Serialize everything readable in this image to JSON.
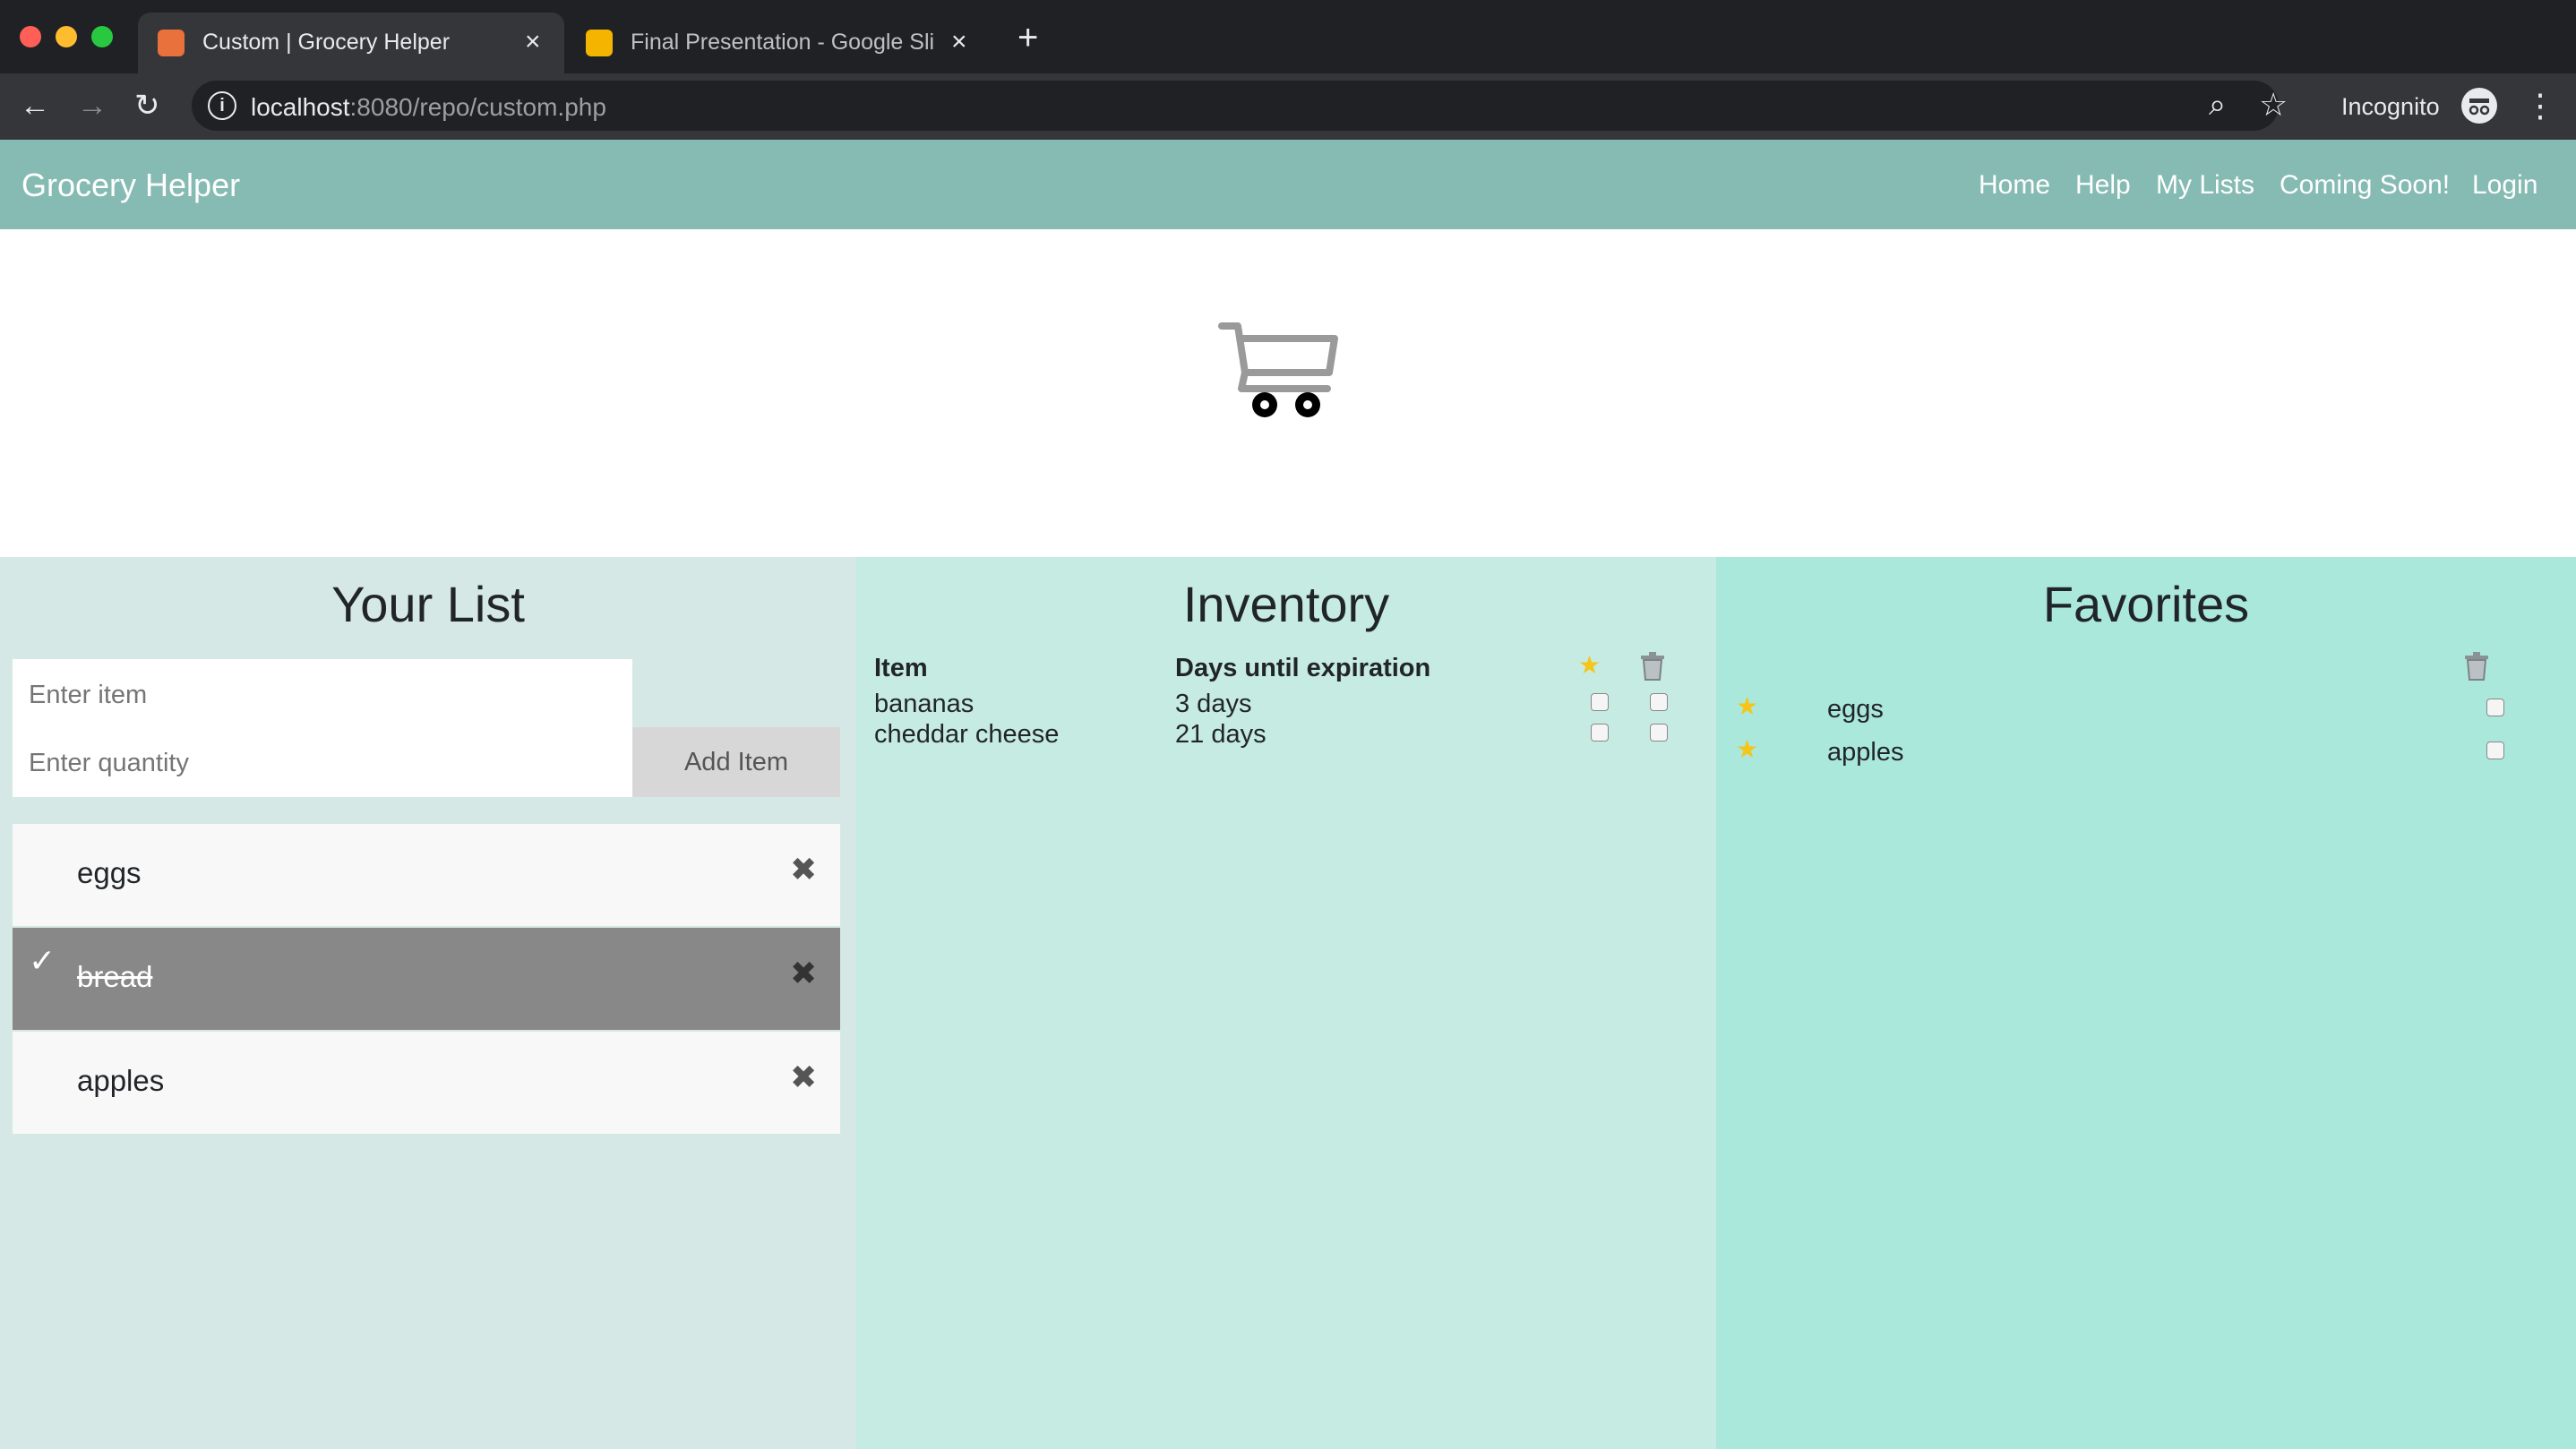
{
  "browser": {
    "tabs": [
      {
        "title": "Custom | Grocery Helper",
        "favicon_color": "#e8713c"
      },
      {
        "title": "Final Presentation - Google Sli",
        "favicon_color": "#f5b400"
      }
    ],
    "new_tab_icon": "plus-icon",
    "url_host": "localhost",
    "url_path": ":8080/repo/custom.php",
    "profile_label": "Incognito"
  },
  "navbar": {
    "brand": "Grocery Helper",
    "links": [
      "Home",
      "Help",
      "My Lists",
      "Coming Soon!",
      "Login"
    ],
    "color": "#86bbb3"
  },
  "hero": {
    "icon": "shopping-cart-icon"
  },
  "your_list": {
    "title": "Your List",
    "item_placeholder": "Enter item",
    "quantity_placeholder": "Enter quantity",
    "add_button": "Add Item",
    "items": [
      {
        "label": "eggs",
        "done": false
      },
      {
        "label": "bread",
        "done": true
      },
      {
        "label": "apples",
        "done": false
      }
    ]
  },
  "inventory": {
    "title": "Inventory",
    "col_item": "Item",
    "col_days": "Days until expiration",
    "rows": [
      {
        "item": "bananas",
        "days": "3 days"
      },
      {
        "item": "cheddar cheese",
        "days": "21 days"
      }
    ]
  },
  "favorites": {
    "title": "Favorites",
    "items": [
      "eggs",
      "apples"
    ]
  },
  "colors": {
    "list_panel": "#d5e8e5",
    "inventory_panel": "#c6ebe2",
    "favorites_panel": "#abe8dc",
    "done_item": "#888888"
  }
}
